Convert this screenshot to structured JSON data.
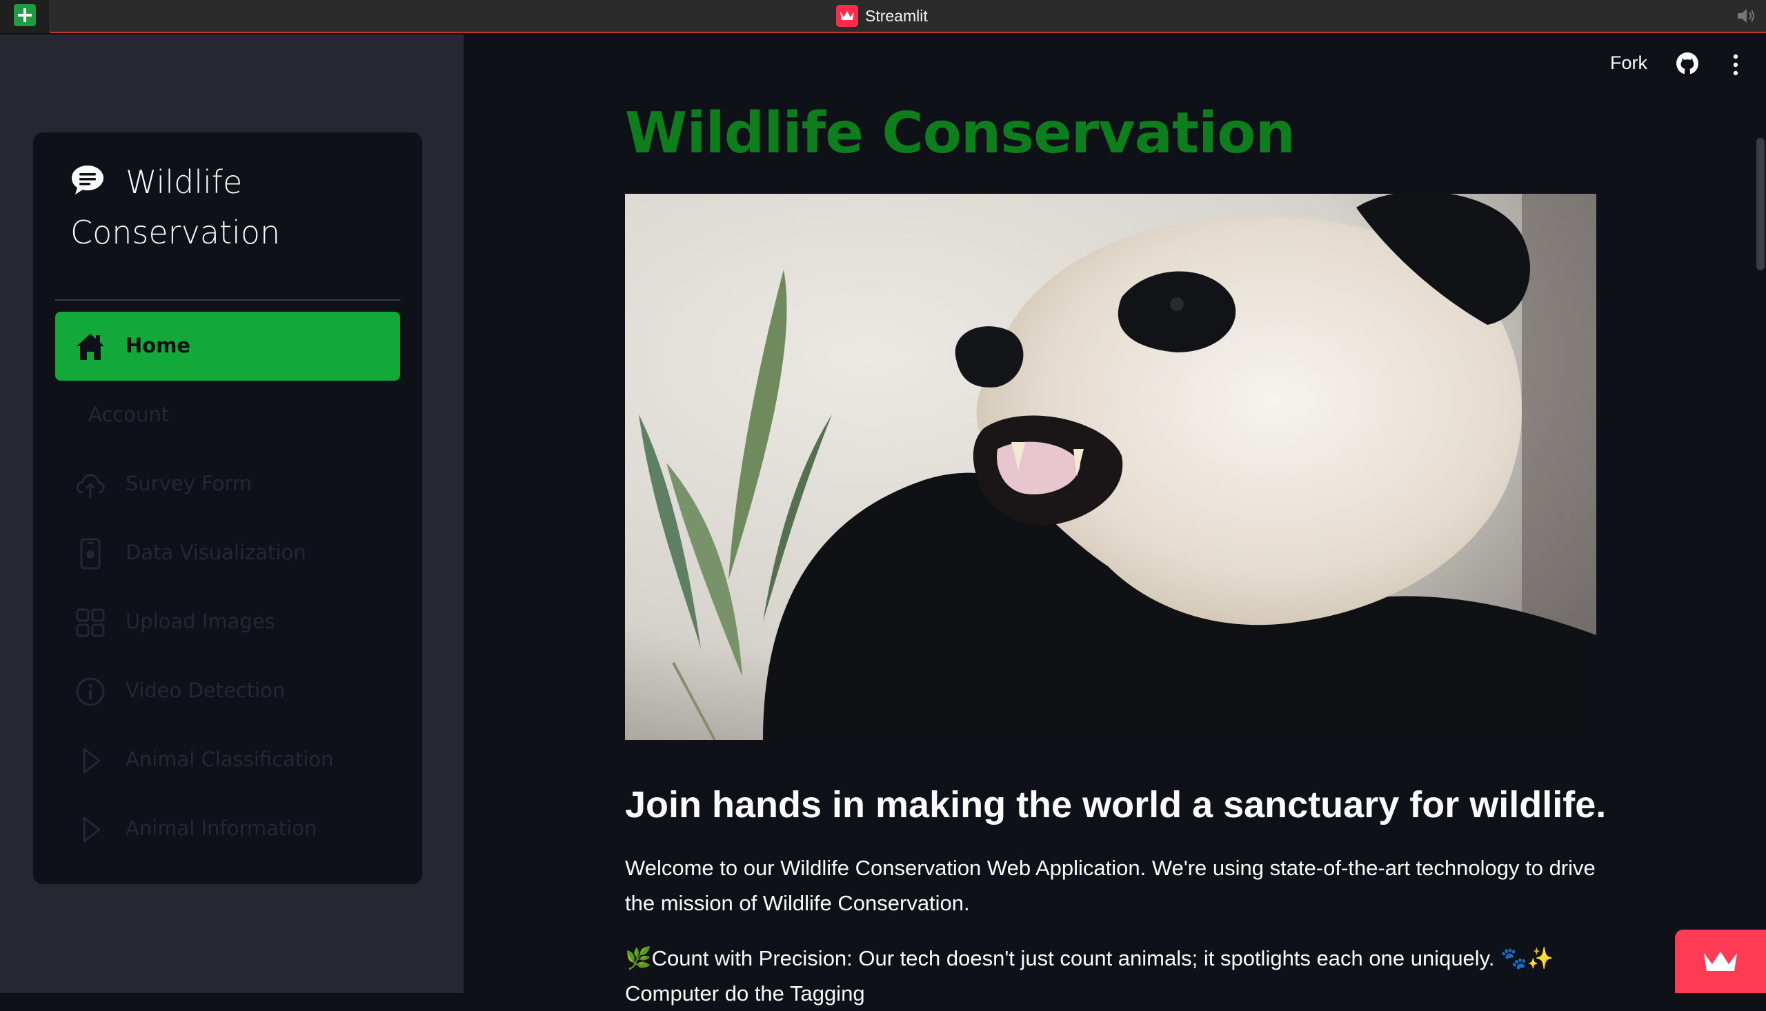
{
  "window": {
    "app_title": "Streamlit",
    "icons": [
      "spreadsheet-add-icon",
      "streamlit-logo-icon",
      "speaker-icon"
    ]
  },
  "header": {
    "fork_label": "Fork",
    "icons": [
      "github-icon",
      "kebab-menu-icon"
    ]
  },
  "sidebar": {
    "title": "Wildlife Conservation",
    "title_icon": "chat-bubble-icon",
    "items": [
      {
        "label": "Home",
        "icon": "house-icon",
        "active": true
      },
      {
        "label": "Account",
        "icon": "",
        "active": false
      },
      {
        "label": "Survey Form",
        "icon": "cloud-upload-icon",
        "active": false
      },
      {
        "label": "Data Visualization",
        "icon": "phone-icon",
        "active": false
      },
      {
        "label": "Upload Images",
        "icon": "grid-icon",
        "active": false
      },
      {
        "label": "Video Detection",
        "icon": "info-icon",
        "active": false
      },
      {
        "label": "Animal Classification",
        "icon": "play-icon",
        "active": false
      },
      {
        "label": "Animal Information",
        "icon": "play-icon",
        "active": false
      }
    ]
  },
  "main": {
    "title": "Wildlife Conservation",
    "hero_image": "panda-photo",
    "tagline": "Join hands in making the world a sanctuary for wildlife.",
    "intro": "Welcome to our Wildlife Conservation Web Application. We're using state-of-the-art technology to drive the mission of Wildlife Conservation.",
    "feature_1": "🌿Count with Precision: Our tech doesn't just count animals; it spotlights each one uniquely. 🐾✨",
    "feature_2": "Computer do the Tagging"
  },
  "colors": {
    "background": "#0e1117",
    "sidebar": "#262730",
    "accent_green": "#13a83a",
    "title_green": "#0e7d1c",
    "streamlit_red": "#ff2b4a"
  }
}
